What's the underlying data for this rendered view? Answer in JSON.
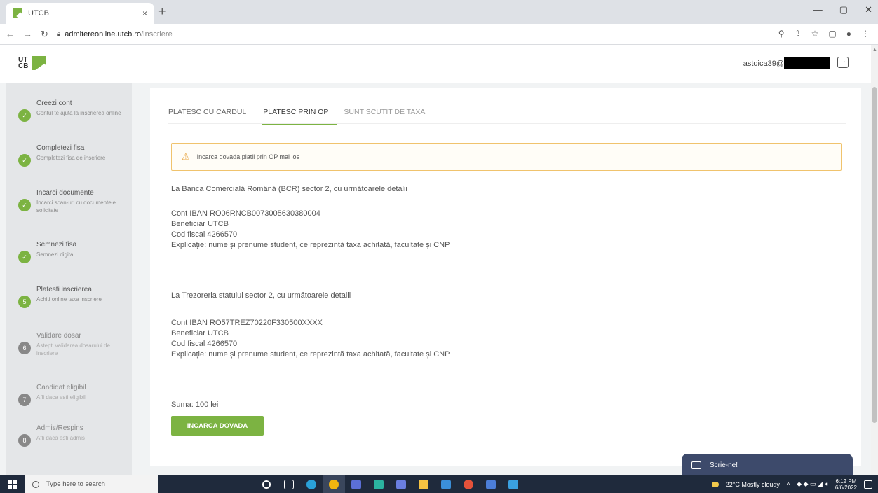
{
  "browser": {
    "tab_title": "UTCB",
    "tab_close": "×",
    "new_tab": "+",
    "url_host": "admitereonline.utcb.ro",
    "url_path": "/inscriere",
    "window_controls": [
      "—",
      "▢",
      "✕"
    ]
  },
  "header": {
    "logo_text": "UT CB",
    "user_email": "astoica39@"
  },
  "sidebar": {
    "steps": [
      {
        "title": "Creezi cont",
        "desc": "Contul te ajuta la inscrierea online",
        "status": "done",
        "num": "✓"
      },
      {
        "title": "Completezi fisa",
        "desc": "Completezi fisa de inscriere",
        "status": "done",
        "num": "✓"
      },
      {
        "title": "Incarci documente",
        "desc": "Incarci scan-uri cu documentele solicitate",
        "status": "done",
        "num": "✓"
      },
      {
        "title": "Semnezi fisa",
        "desc": "Semnezi digital",
        "status": "done",
        "num": "✓"
      },
      {
        "title": "Platesti inscrierea",
        "desc": "Achiti online taxa inscriere",
        "status": "active",
        "num": "5"
      },
      {
        "title": "Validare dosar",
        "desc": "Astepti validarea dosarului de inscriere",
        "status": "pending",
        "num": "6"
      },
      {
        "title": "Candidat eligibil",
        "desc": "Afli daca esti eligibil",
        "status": "pending",
        "num": "7"
      },
      {
        "title": "Admis/Respins",
        "desc": "Afli daca esti admis",
        "status": "pending",
        "num": "8"
      }
    ]
  },
  "main": {
    "tabs": [
      {
        "label": "PLATESC CU CARDUL",
        "state": "normal"
      },
      {
        "label": "PLATESC PRIN OP",
        "state": "active"
      },
      {
        "label": "SUNT SCUTIT DE TAXA",
        "state": "dim"
      }
    ],
    "alert_text": "Incarca dovada platii prin OP mai jos",
    "bcr_intro": "La Banca Comercială Română (BCR) sector 2, cu următoarele detalii",
    "bcr_iban": "Cont IBAN RO06RNCB0073005630380004",
    "bcr_beneficiar": "Beneficiar UTCB",
    "bcr_cod": "Cod fiscal 4266570",
    "bcr_explicatie": "Explicație: nume și prenume student, ce reprezintă taxa achitată, facultate și CNP",
    "trez_intro": "La Trezoreria statului sector 2, cu următoarele detalii",
    "trez_iban": "Cont IBAN RO57TREZ70220F330500XXXX",
    "trez_beneficiar": "Beneficiar UTCB",
    "trez_cod": "Cod fiscal 4266570",
    "trez_explicatie": "Explicație: nume și prenume student, ce reprezintă taxa achitată, facultate și CNP",
    "sum": "Suma: 100 lei",
    "upload_button": "INCARCA DOVADA"
  },
  "chat": {
    "label": "Scrie-ne!"
  },
  "taskbar": {
    "search_placeholder": "Type here to search",
    "weather": "22°C Mostly cloudy",
    "time": "6:12 PM",
    "date": "6/6/2022"
  },
  "colors": {
    "accent": "#7cb342",
    "warning": "#f0c36d",
    "chat": "#3d4a6b"
  }
}
